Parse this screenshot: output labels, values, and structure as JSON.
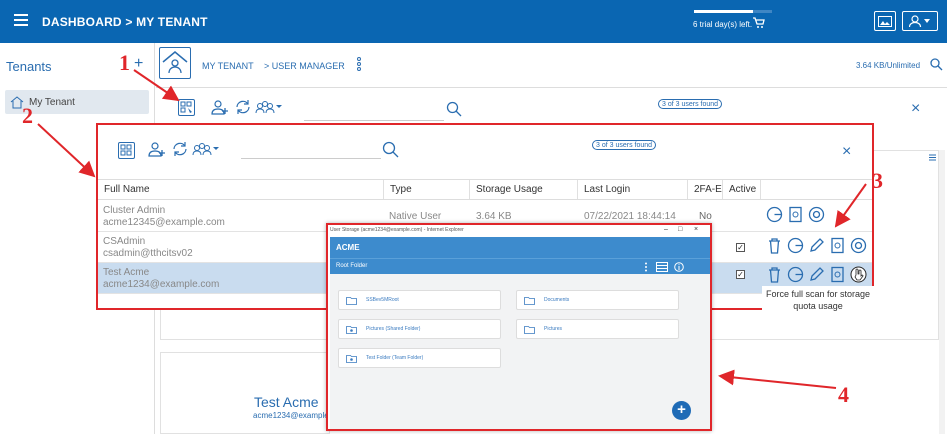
{
  "topbar": {
    "title": "DASHBOARD > MY TENANT",
    "trial_text": "6 trial day(s) left.",
    "trial_progress": 0.75,
    "colors": {
      "brand": "#0a66b2",
      "annotation": "#e0262a",
      "selected_row": "#c9dcef"
    }
  },
  "sidebar": {
    "title": "Tenants",
    "add_label": "+",
    "items": [
      {
        "label": "My Tenant"
      }
    ]
  },
  "header": {
    "crumb_tenant": "MY TENANT",
    "crumb_user_manager": "> USER MANAGER",
    "storage": "3.64 KB/Unlimited"
  },
  "toolbar": {
    "found": "3 of 3 users found",
    "close": "×"
  },
  "user_table": {
    "found": "3 of 3 users found",
    "close": "×",
    "columns": [
      "Full Name",
      "Type",
      "Storage Usage",
      "Last Login",
      "2FA-E",
      "Active"
    ],
    "rows": [
      {
        "name": "Cluster Admin",
        "email": "acme12345@example.com",
        "type": "Native User",
        "storage": "3.64 KB",
        "last_login": "07/22/2021 18:44:14",
        "twofa": "No",
        "active": ""
      },
      {
        "name": "CSAdmin",
        "email": "csadmin@tthcitsv02",
        "type": "",
        "storage": "",
        "last_login": "",
        "twofa": "",
        "active": "✓"
      },
      {
        "name": "Test Acme",
        "email": "acme1234@example.com",
        "type": "",
        "storage": "",
        "last_login": "",
        "twofa": "",
        "active": "✓"
      }
    ],
    "tooltip": "Force full scan for storage quota usage"
  },
  "popup": {
    "title": "User Storage (acme1234@example.com) - Internet Explorer",
    "win_minimize": "–",
    "win_maximize": "□",
    "win_close": "×",
    "header": "ACME",
    "subtitle": "Root Folder",
    "folders": [
      {
        "label": "SSBev5MRoot"
      },
      {
        "label": "Documents"
      },
      {
        "label": "Pictures (Shared Folder)"
      },
      {
        "label": "Pictures"
      },
      {
        "label": "Test Folder (Team Folder)"
      }
    ],
    "fab": "+"
  },
  "card": {
    "name": "Test Acme",
    "email": "acme1234@example.com"
  },
  "annotations": {
    "one": "1",
    "two": "2",
    "three": "3",
    "four": "4"
  }
}
